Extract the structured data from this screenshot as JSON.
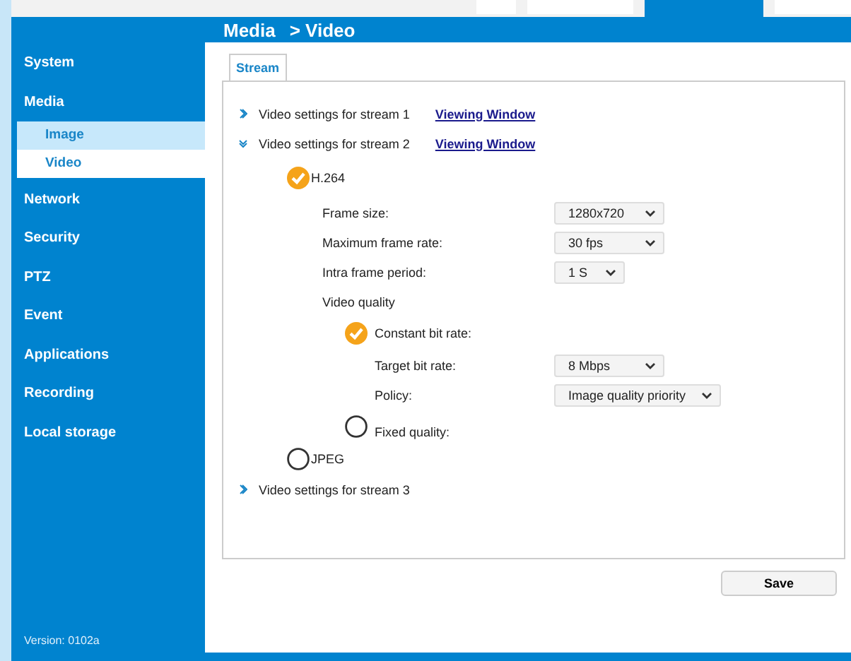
{
  "nav_tabs": [
    {
      "selected": false
    },
    {
      "selected": false
    },
    {
      "selected": true
    },
    {
      "selected": false
    }
  ],
  "breadcrumb": [
    "Media",
    "> Video"
  ],
  "sidebar": {
    "items": [
      {
        "label": "System",
        "selected": false
      },
      {
        "label": "Media",
        "selected": false,
        "children": [
          {
            "label": "Image",
            "selected": false
          },
          {
            "label": "Video",
            "selected": true
          }
        ]
      },
      {
        "label": "Network",
        "selected": false
      },
      {
        "label": "Security",
        "selected": false
      },
      {
        "label": "PTZ",
        "selected": false
      },
      {
        "label": "Event",
        "selected": false
      },
      {
        "label": "Applications",
        "selected": false
      },
      {
        "label": "Recording",
        "selected": false
      },
      {
        "label": "Local storage",
        "selected": false
      }
    ],
    "version": "Version: 0102a"
  },
  "tabs": [
    {
      "label": "Stream",
      "selected": true
    }
  ],
  "streams": [
    {
      "label": "Video settings for stream 1",
      "expanded": false,
      "link": "Viewing Window"
    },
    {
      "label": "Video settings for stream 2",
      "expanded": true,
      "link": "Viewing Window",
      "codecs": [
        {
          "label": "H.264",
          "selected": true,
          "fields": [
            {
              "label": "Frame size:",
              "value": "1280x720"
            },
            {
              "label": "Maximum frame rate:",
              "value": "30 fps"
            },
            {
              "label": "Intra frame period:",
              "value": "1 S"
            }
          ],
          "quality": {
            "label": "Video quality",
            "modes": [
              {
                "label": "Constant bit rate:",
                "selected": true,
                "fields": [
                  {
                    "label": "Target bit rate:",
                    "value": "8 Mbps"
                  },
                  {
                    "label": "Policy:",
                    "value": "Image quality priority"
                  }
                ]
              },
              {
                "label": "Fixed quality:",
                "selected": false
              }
            ]
          }
        },
        {
          "label": "JPEG",
          "selected": false
        }
      ]
    },
    {
      "label": "Video settings for stream 3",
      "expanded": false
    }
  ],
  "buttons": [
    "Save"
  ]
}
